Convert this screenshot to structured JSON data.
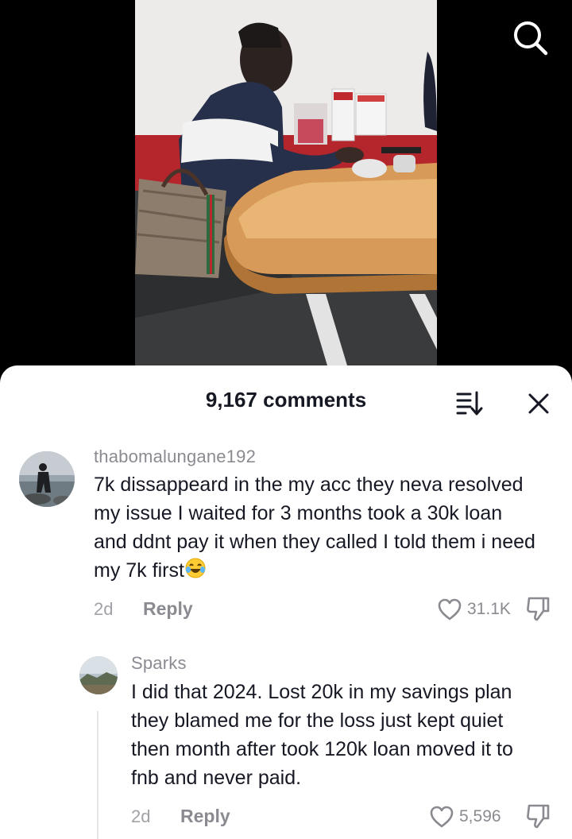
{
  "header": {
    "comment_count_label": "9,167 comments"
  },
  "icons": {
    "search": "search-icon",
    "sort": "sort-icon",
    "close": "close-icon",
    "like": "heart-icon",
    "dislike": "thumbs-down-icon",
    "emoji": "laughing-tears-emoji"
  },
  "comments": [
    {
      "username": "thabomalungane192",
      "text": "7k dissappeard in the my acc they neva resolved my issue I waited for 3 months took a 30k loan and ddnt pay it when they called I told them i need my 7k first",
      "time": "2d",
      "reply_label": "Reply",
      "likes": "31.1K"
    },
    {
      "username": "Sparks",
      "text": "I did that 2024. Lost 20k in my savings plan they blamed me for the loss just kept quiet then month after took 120k loan moved it to fnb and never paid.",
      "time": "2d",
      "reply_label": "Reply",
      "likes": "5,596"
    }
  ],
  "colors": {
    "primary_text": "#161823",
    "secondary_text": "#8a8b91",
    "sheet_background": "#ffffff"
  }
}
